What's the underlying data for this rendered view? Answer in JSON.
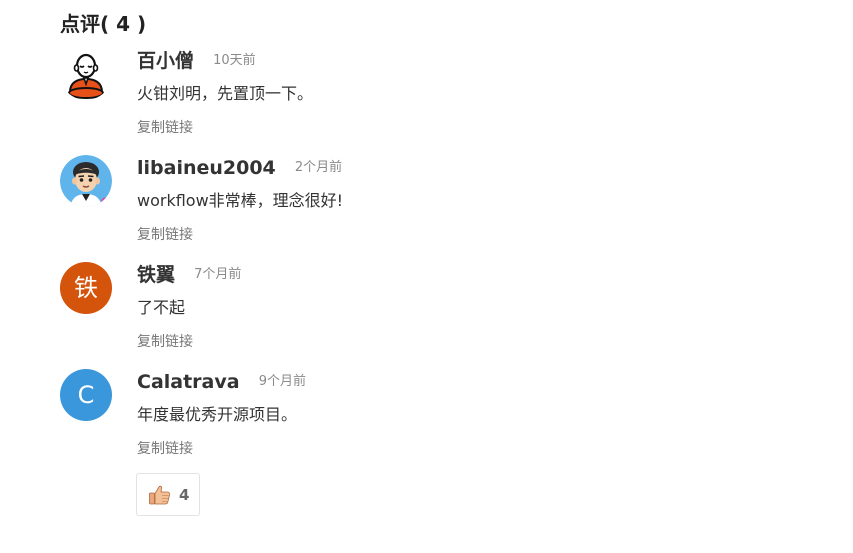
{
  "section": {
    "title": "点评",
    "count_text": "( 4 )"
  },
  "comments": [
    {
      "author": "百小僧",
      "time": "10天前",
      "content": "火钳刘明，先置顶一下。",
      "copy_link_label": "复制链接",
      "avatar_type": "monk-icon"
    },
    {
      "author": "libaineu2004",
      "time": "2个月前",
      "content": "workflow非常棒，理念很好!",
      "copy_link_label": "复制链接",
      "avatar_type": "cartoon-face-icon"
    },
    {
      "author": "铁翼",
      "time": "7个月前",
      "content": "了不起",
      "copy_link_label": "复制链接",
      "avatar_letter": "铁",
      "avatar_color": "#d5540b"
    },
    {
      "author": "Calatrava",
      "time": "9个月前",
      "content": "年度最优秀开源项目。",
      "copy_link_label": "复制链接",
      "avatar_letter": "C",
      "avatar_color": "#3b97db"
    }
  ],
  "like": {
    "icon": "thumbs-up-icon",
    "count": "4"
  }
}
